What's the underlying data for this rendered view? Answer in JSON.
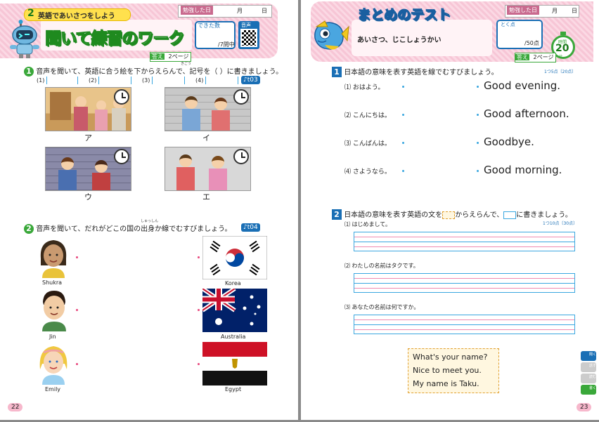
{
  "left": {
    "unit_number": "2",
    "unit_title": "英語であいさつをしよう",
    "study_date_label": "勉強した日",
    "month_label": "月",
    "day_label": "日",
    "page_title": "聞いて練習のワーク",
    "done_label": "できた数",
    "done_total": "/7問中",
    "audio_label": "音声",
    "answers_label": "答え",
    "answers_page": "2ページ",
    "page_number": "22",
    "q1": {
      "num": "1",
      "text": "音声を聞いて、英語に合う絵を下からえらんで、記号を（ ）に書きましょう。",
      "ruby": "きごう",
      "blanks": [
        "(1)",
        "(2)",
        "(3)",
        "(4)"
      ],
      "track": "t03",
      "pictures": [
        "ア",
        "イ",
        "ウ",
        "エ"
      ]
    },
    "q2": {
      "num": "2",
      "text": "音声を聞いて、だれがどこの国の出身か線でむすびましょう。",
      "ruby": "しゅっしん",
      "track": "t04",
      "people": [
        "Shukra",
        "Jin",
        "Emily"
      ],
      "countries": [
        "Korea",
        "Australia",
        "Egypt"
      ]
    }
  },
  "right": {
    "test_title": "まとめのテスト",
    "topic": "あいさつ、じこしょうかい",
    "study_date_label": "勉強した日",
    "month_label": "月",
    "day_label": "日",
    "score_label": "とく点",
    "score_total": "/50点",
    "time_label": "時間",
    "time_value": "20",
    "time_unit": "分",
    "answers_label": "答え",
    "answers_page": "2ページ",
    "page_number": "23",
    "q1": {
      "num": "1",
      "text": "日本語の意味を表す英語を線でむすびましょう。",
      "points": "1つ5点〔20点〕",
      "japanese": [
        "⑴ おはよう。",
        "⑵ こんにちは。",
        "⑶ こんばんは。",
        "⑷ さようなら。"
      ],
      "english": [
        "Good evening.",
        "Good afternoon.",
        "Goodbye.",
        "Good morning."
      ]
    },
    "q2": {
      "num": "2",
      "text_a": "日本語の意味を表す英語の文を",
      "text_b": "からえらんで、",
      "text_c": "に書きましょう。",
      "points": "1つ10点〔30点〕",
      "items": [
        "⑴ はじめまして。",
        "⑵ わたしの名前はタクです。",
        "⑶ あなたの名前は何ですか。"
      ],
      "choices": [
        "What's your name?",
        "Nice to meet you.",
        "My name is Taku."
      ]
    },
    "side_tabs": [
      "聞く",
      "話す",
      "読む",
      "書く"
    ]
  },
  "colors": {
    "pink_band": "#f7c6d6",
    "green": "#3aa83a",
    "blue": "#1a6fb5",
    "light_blue": "#3aa7e0",
    "pink_dot": "#e8467c"
  }
}
